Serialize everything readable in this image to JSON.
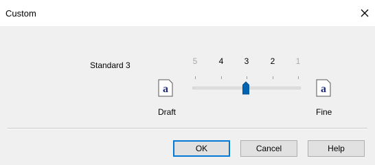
{
  "dialog": {
    "title": "Custom",
    "close_icon": "close-icon"
  },
  "quality": {
    "label": "Standard 3",
    "ticks": [
      "5",
      "4",
      "3",
      "2",
      "1"
    ],
    "selected": "3",
    "left_caption": "Draft",
    "right_caption": "Fine",
    "icon_glyph": "a"
  },
  "buttons": {
    "ok": "OK",
    "cancel": "Cancel",
    "help": "Help"
  },
  "colors": {
    "thumb": "#0063b1",
    "default_button_border": "#0078d7",
    "icon_letter": "#1f2a7a"
  }
}
